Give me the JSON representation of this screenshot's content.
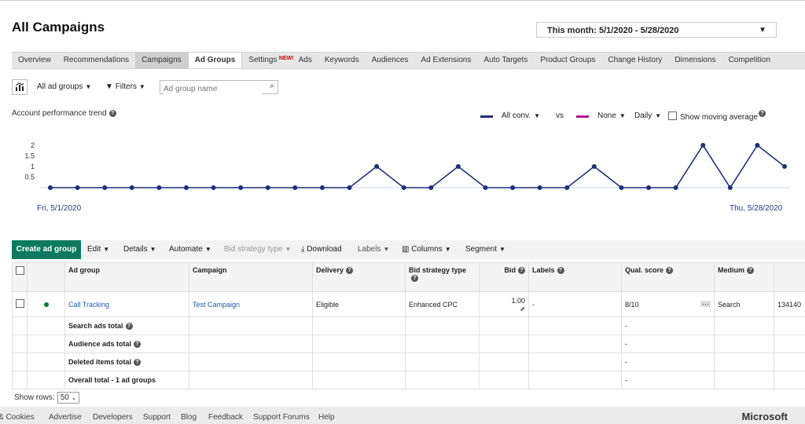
{
  "page": {
    "title": "All Campaigns"
  },
  "date_range": {
    "label": "This month: 5/1/2020 - 5/28/2020"
  },
  "tabs": [
    {
      "label": "Overview"
    },
    {
      "label": "Recommendations"
    },
    {
      "label": "Campaigns"
    },
    {
      "label": "Ad Groups"
    },
    {
      "label": "Settings",
      "badge": "NEW!"
    },
    {
      "label": "Ads"
    },
    {
      "label": "Keywords"
    },
    {
      "label": "Audiences"
    },
    {
      "label": "Ad Extensions"
    },
    {
      "label": "Auto Targets"
    },
    {
      "label": "Product Groups"
    },
    {
      "label": "Change History"
    },
    {
      "label": "Dimensions"
    },
    {
      "label": "Competition"
    }
  ],
  "filters": {
    "scope_label": "All ad groups",
    "filters_label": "Filters",
    "search_placeholder": "Ad group name"
  },
  "trend": {
    "label": "Account performance trend",
    "metric1": "All conv.",
    "vs": "vs",
    "metric2": "None",
    "granularity": "Daily",
    "moving_avg": "Show moving average",
    "metric1_color": "#1c2f7c",
    "metric2_color": "#b0168c",
    "x_start": "Fri, 5/1/2020",
    "x_end": "Thu, 5/28/2020"
  },
  "chart_data": {
    "type": "line",
    "title": "",
    "xlabel": "",
    "ylabel": "",
    "yticks": [
      "2",
      "1.5",
      "1",
      "0.5"
    ],
    "ylim": [
      0,
      2
    ],
    "x": [
      "5/1",
      "5/2",
      "5/3",
      "5/4",
      "5/5",
      "5/6",
      "5/7",
      "5/8",
      "5/9",
      "5/10",
      "5/11",
      "5/12",
      "5/13",
      "5/14",
      "5/15",
      "5/16",
      "5/17",
      "5/18",
      "5/19",
      "5/20",
      "5/21",
      "5/22",
      "5/23",
      "5/24",
      "5/25",
      "5/26",
      "5/27",
      "5/28"
    ],
    "series": [
      {
        "name": "All conv.",
        "color": "#1c2f7c",
        "values": [
          0,
          0,
          0,
          0,
          0,
          0,
          0,
          0,
          0,
          0,
          0,
          0,
          1,
          0,
          0,
          1,
          0,
          0,
          0,
          0,
          1,
          0,
          0,
          0,
          2,
          0,
          2,
          1
        ]
      }
    ],
    "grid": false
  },
  "toolbar": {
    "create": "Create ad group",
    "edit": "Edit",
    "details": "Details",
    "automate": "Automate",
    "bid_strategy": "Bid strategy type",
    "download": "Download",
    "labels": "Labels",
    "columns": "Columns",
    "segment": "Segment"
  },
  "table": {
    "headers": {
      "ad_group": "Ad group",
      "campaign": "Campaign",
      "delivery": "Delivery",
      "bid_strategy": "Bid strategy type",
      "bid": "Bid",
      "labels": "Labels",
      "qual_score": "Qual. score",
      "medium": "Medium"
    },
    "row": {
      "ad_group": "Call Tracking",
      "campaign": "Test Campaign",
      "delivery": "Eligible",
      "bid_strategy": "Enhanced CPC",
      "bid": "1.00",
      "labels": "-",
      "qual_score": "8/10",
      "medium": "Search",
      "extra": "134140"
    },
    "totals": [
      {
        "label": "Search ads total",
        "help": true,
        "qs": "-"
      },
      {
        "label": "Audience ads total",
        "help": true,
        "qs": "-"
      },
      {
        "label": "Deleted items total",
        "help": true,
        "qs": "-"
      },
      {
        "label": "Overall total - 1 ad groups",
        "help": false,
        "qs": "-"
      }
    ]
  },
  "pagination": {
    "label": "Show rows:",
    "value": "50"
  },
  "footer": {
    "links": [
      "& Cookies",
      "Advertise",
      "Developers",
      "Support",
      "Blog",
      "Feedback",
      "Support Forums",
      "Help"
    ],
    "brand": "Microsoft"
  }
}
